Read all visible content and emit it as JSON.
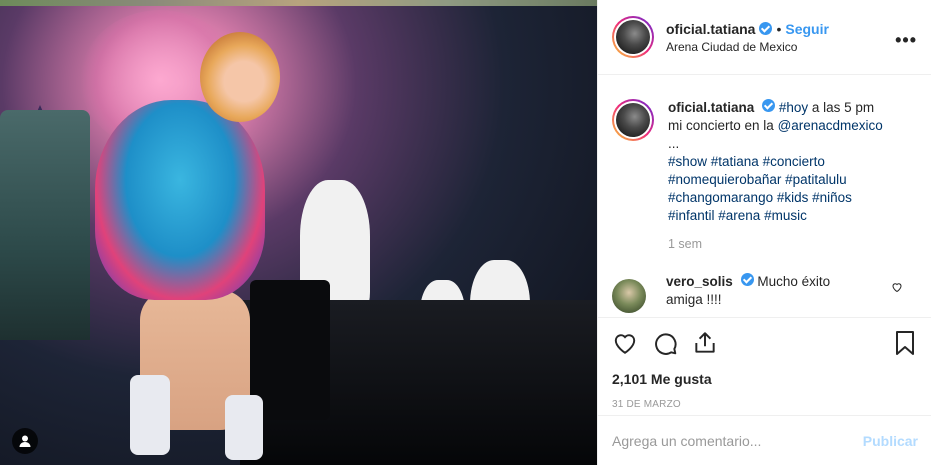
{
  "post": {
    "username": "oficial.tatiana",
    "separator": "•",
    "follow_label": "Seguir",
    "location": "Arena Ciudad de Mexico",
    "more_label": "•••"
  },
  "caption": {
    "username": "oficial.tatiana",
    "text_parts": [
      {
        "text": "#hoy",
        "type": "hashtag"
      },
      {
        "text": " a las 5 pm mi concierto en la ",
        "type": "text"
      },
      {
        "text": "@arenacdmexico",
        "type": "hashtag"
      },
      {
        "text": " ...",
        "type": "text"
      }
    ],
    "hashtags_line1": "#show #tatiana #concierto",
    "hashtags_line2": "#nomequierobañar #patitalulu",
    "hashtags_line3": "#changomarango #kids #niños",
    "hashtags_line4": "#infantil #arena #music"
  },
  "age": "1 sem",
  "comment": {
    "username": "vero_solis",
    "text": "Mucho éxito amiga !!!!"
  },
  "engagement": {
    "likes": "2,101 Me gusta",
    "date": "31 DE MARZO"
  },
  "add_comment": {
    "placeholder": "Agrega un comentario...",
    "post_label": "Publicar"
  },
  "colors": {
    "link": "#3897f0",
    "hashtag": "#003569",
    "muted": "#999999",
    "publish_disabled": "#b3dbff"
  },
  "icons": [
    "user-tag-icon",
    "verified-icon",
    "more-icon",
    "heart-icon",
    "comment-icon",
    "share-icon",
    "bookmark-icon",
    "heart-small-icon"
  ]
}
